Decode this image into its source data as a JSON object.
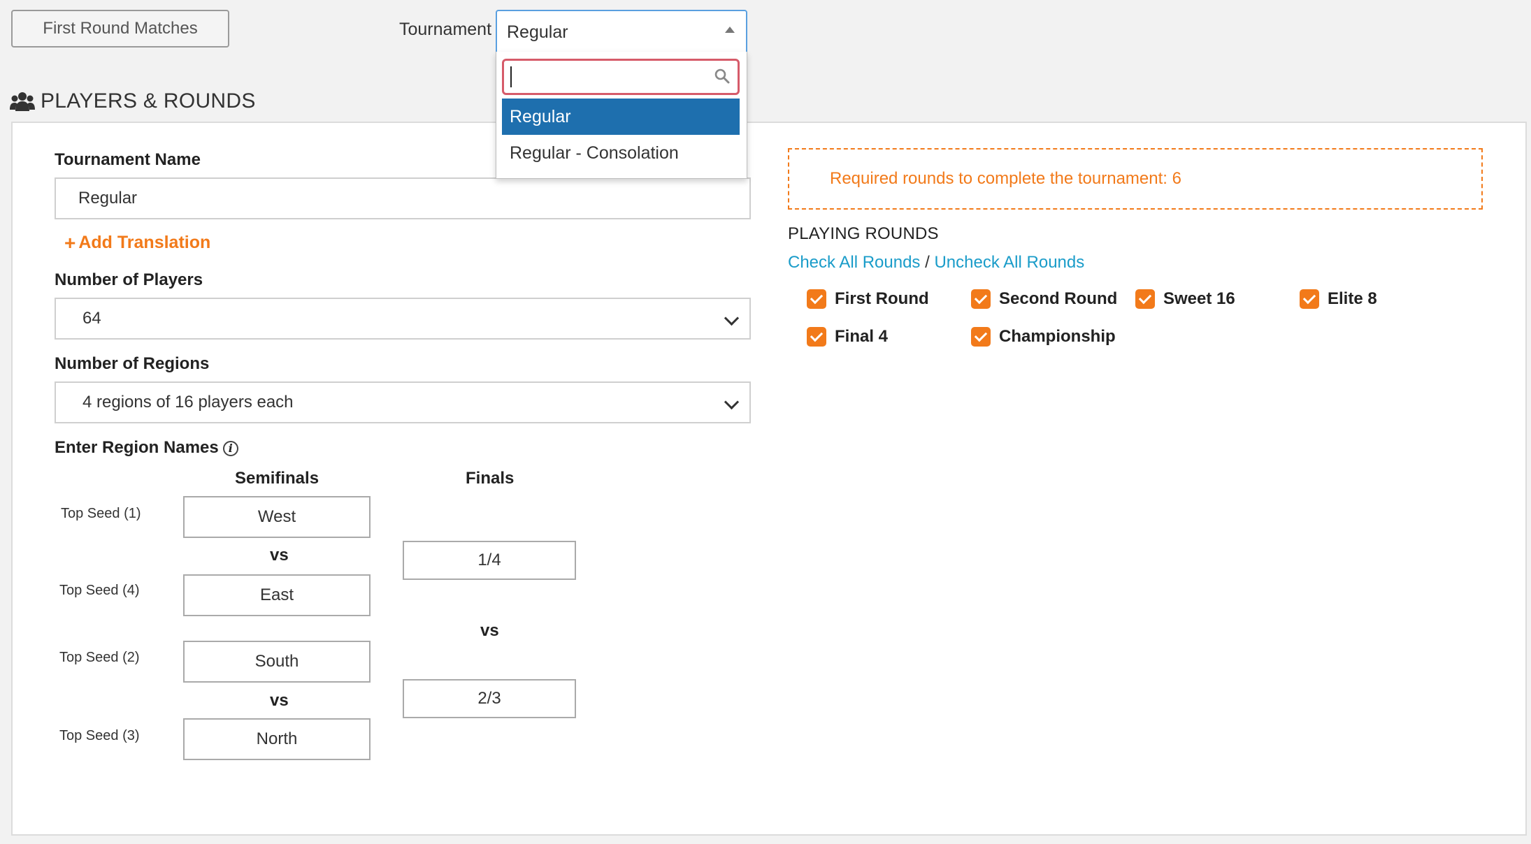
{
  "toolbar": {
    "first_round_matches_label": "First Round Matches",
    "tournament_label": "Tournament",
    "tournament_value": "Regular"
  },
  "dropdown": {
    "search_value": "",
    "options": [
      "Regular",
      "Regular - Consolation"
    ],
    "selected_index": 0
  },
  "section": {
    "title": "PLAYERS & ROUNDS"
  },
  "form": {
    "tournament_name_label": "Tournament Name",
    "tournament_name_value": "Regular",
    "add_translation": "Add Translation",
    "num_players_label": "Number of Players",
    "num_players_value": "64",
    "num_regions_label": "Number of Regions",
    "num_regions_value": "4 regions of 16 players each",
    "region_names_label": "Enter Region Names"
  },
  "regions": {
    "semifinals_header": "Semifinals",
    "finals_header": "Finals",
    "vs_label": "vs",
    "seeds": [
      {
        "label": "Top Seed (1)",
        "name": "West"
      },
      {
        "label": "Top Seed (4)",
        "name": "East"
      },
      {
        "label": "Top Seed (2)",
        "name": "South"
      },
      {
        "label": "Top Seed (3)",
        "name": "North"
      }
    ],
    "finals": [
      "1/4",
      "2/3"
    ]
  },
  "rounds": {
    "required_text": "Required rounds to complete the tournament: 6",
    "playing_title": "PLAYING ROUNDS",
    "check_all": "Check All Rounds",
    "separator": "/",
    "uncheck_all": "Uncheck All Rounds",
    "items": [
      {
        "label": "First Round",
        "checked": true
      },
      {
        "label": "Second Round",
        "checked": true
      },
      {
        "label": "Sweet 16",
        "checked": true
      },
      {
        "label": "Elite 8",
        "checked": true
      },
      {
        "label": "Final 4",
        "checked": true
      },
      {
        "label": "Championship",
        "checked": true
      }
    ]
  },
  "colors": {
    "accent_orange": "#f27a1a",
    "link_blue": "#1a9cc9",
    "selected_blue": "#1e6fae",
    "search_border": "#d65b6a"
  },
  "icons": {
    "section": "users-icon",
    "search": "search-icon",
    "info": "info-icon",
    "plus": "plus-icon"
  }
}
